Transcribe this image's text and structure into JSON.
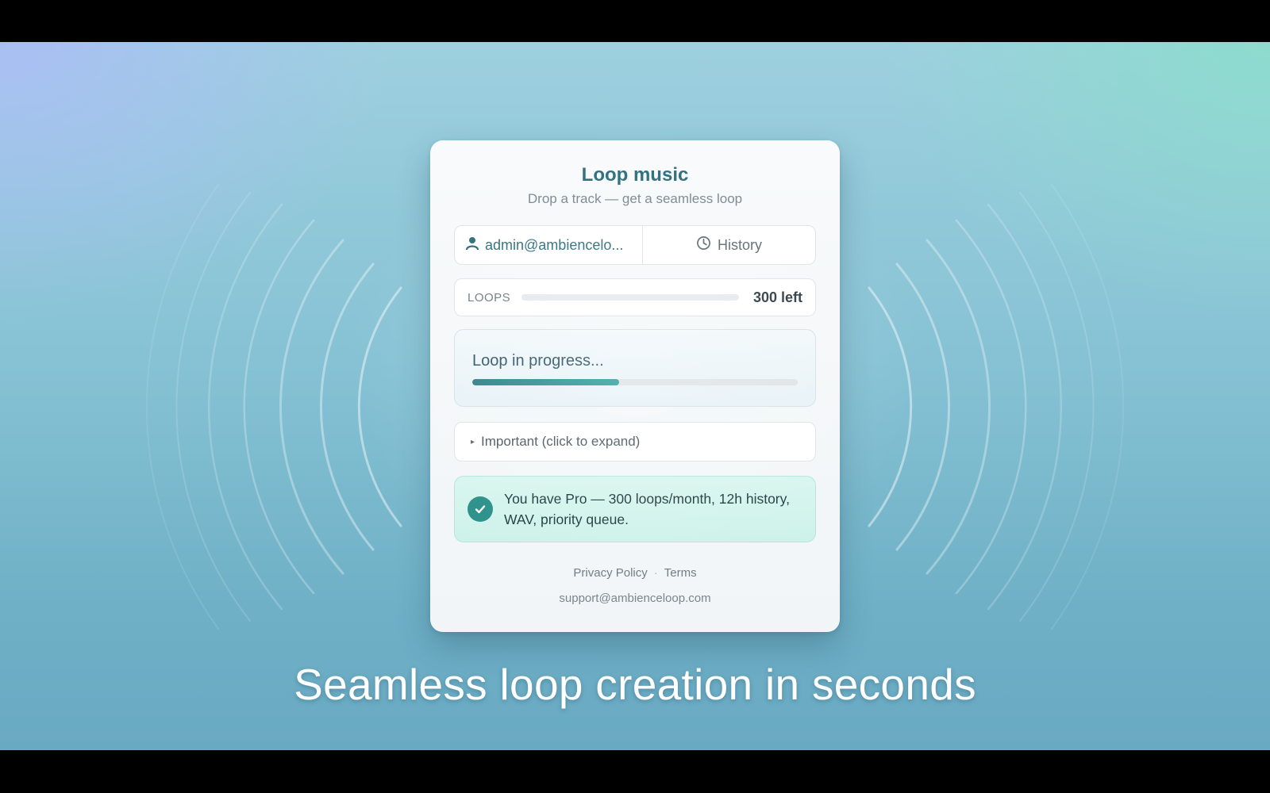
{
  "card": {
    "title": "Loop music",
    "subtitle": "Drop a track — get a seamless loop"
  },
  "account": {
    "email": "admin@ambiencelo...",
    "icon": "user-icon"
  },
  "history": {
    "label": "History",
    "icon": "clock-icon"
  },
  "loops": {
    "label": "LOOPS",
    "remaining": "300 left"
  },
  "progress": {
    "label": "Loop in progress...",
    "fraction": 0.45
  },
  "details": {
    "label": "Important (click to expand)"
  },
  "pro": {
    "message": "You have Pro — 300 loops/month, 12h history, WAV, priority queue.",
    "icon": "check-icon"
  },
  "footer": {
    "privacy": "Privacy Policy",
    "terms": "Terms",
    "support": "support@ambienceloop.com"
  },
  "caption": "Seamless loop creation in seconds",
  "colors": {
    "accent": "#2b6d7c",
    "progress": "#2fa3a0",
    "pro_bg": "#d8f6ee",
    "check": "#2a8f8a"
  }
}
